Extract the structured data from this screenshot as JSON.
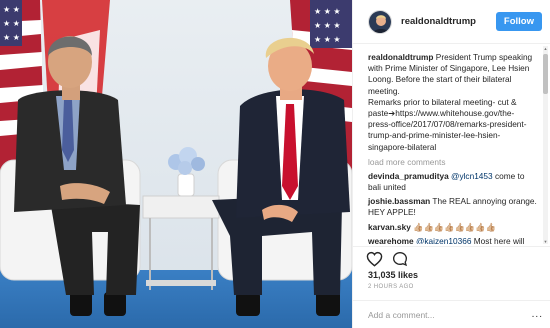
{
  "post": {
    "username": "realdonaldtrump",
    "follow_label": "Follow",
    "caption_user": "realdonaldtrump",
    "caption_text": "President Trump speaking with Prime Minister of Singapore, Lee Hsien Loong. Before the start of their bilateral meeting.",
    "caption_remarks": "Remarks prior to bilateral meeting- cut & paste➔https://www.whitehouse.gov/the-press-office/2017/07/08/remarks-president-trump-and-prime-minister-lee-hsien-singapore-bilateral",
    "load_more_label": "load more comments",
    "likes": "31,035 likes",
    "time": "2 HOURS AGO",
    "add_comment_placeholder": "Add a comment...",
    "more_options": "..."
  },
  "comments": [
    {
      "user": "devinda_pramuditya",
      "mention": "@ylcn1453",
      "text": " come to bali united"
    },
    {
      "user": "joshie.bassman",
      "mention": "",
      "text": " The REAL annoying orange. HEY APPLE!"
    },
    {
      "user": "karvan.sky",
      "mention": "",
      "text": " 👍🏼👍🏼👍🏼👍🏼👍🏼👍🏼👍🏼👍🏼"
    },
    {
      "user": "wearehome",
      "mention": "@kaizen10366",
      "text": " Most here will"
    }
  ],
  "icons": {
    "like": "heart-icon",
    "comment": "speech-bubble-icon",
    "avatar": "avatar"
  },
  "colors": {
    "follow_button": "#3897f0",
    "mention": "#003569",
    "muted": "#999999"
  }
}
